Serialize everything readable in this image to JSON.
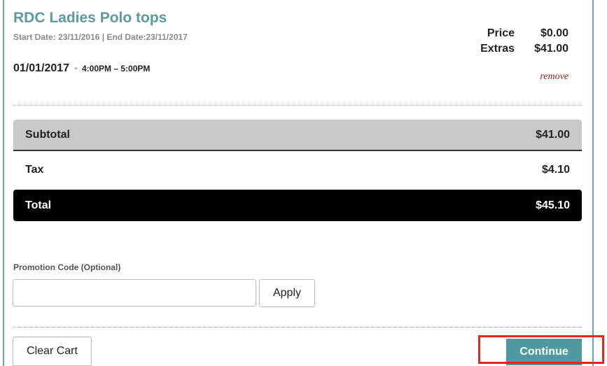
{
  "product": {
    "title": "RDC Ladies Polo tops",
    "date_range": "Start Date: 23/11/2016 | End Date:23/11/2017",
    "booking_date": "01/01/2017",
    "booking_separator": "•",
    "booking_time": "4:00PM – 5:00PM"
  },
  "pricing": {
    "price_label": "Price",
    "price_value": "$0.00",
    "extras_label": "Extras",
    "extras_value": "$41.00",
    "remove_label": "remove"
  },
  "summary": {
    "subtotal_label": "Subtotal",
    "subtotal_value": "$41.00",
    "tax_label": "Tax",
    "tax_value": "$4.10",
    "total_label": "Total",
    "total_value": "$45.10"
  },
  "promo": {
    "label": "Promotion Code (Optional)",
    "value": "",
    "apply_label": "Apply"
  },
  "actions": {
    "clear_cart_label": "Clear Cart",
    "continue_label": "Continue"
  },
  "colors": {
    "title": "#5b9aa0",
    "continue_bg": "#4e9a9e",
    "subtotal_bg": "#c9c9c9",
    "total_bg": "#000000",
    "remove_link": "#8b1a1a",
    "highlight": "#e8271c"
  }
}
